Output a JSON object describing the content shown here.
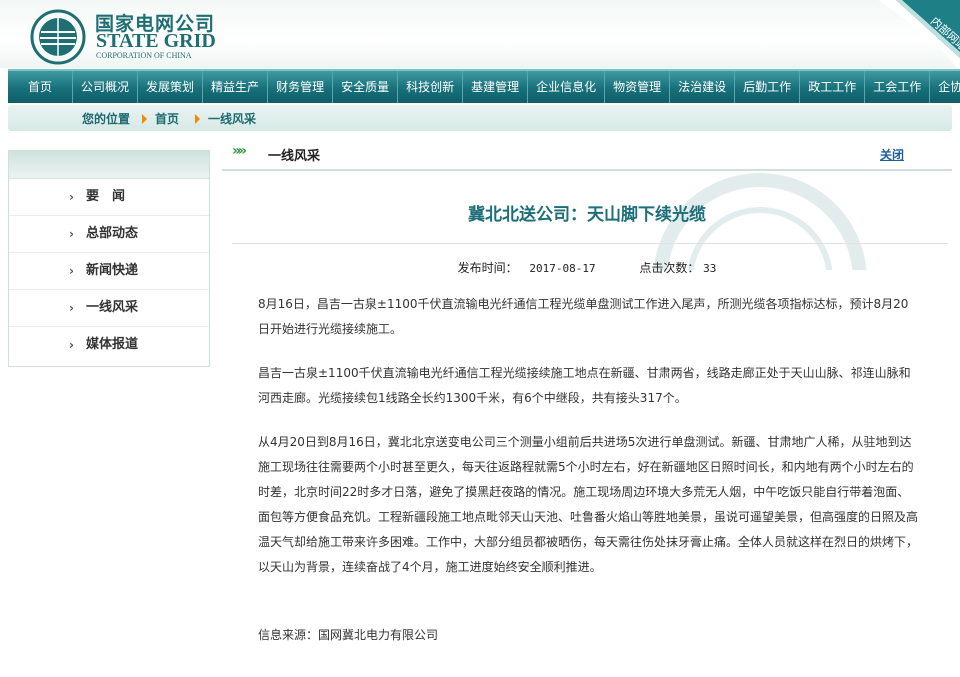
{
  "header": {
    "logo_cn": "国家电网公司",
    "logo_en": "STATE GRID",
    "logo_en_sub": "CORPORATION OF CHINA",
    "corner_badge": "内部网站"
  },
  "nav": {
    "items": [
      "首页",
      "公司概况",
      "发展策划",
      "精益生产",
      "财务管理",
      "安全质量",
      "科技创新",
      "基建管理",
      "企业信息化",
      "物资管理",
      "法治建设",
      "后勤工作",
      "政工工作",
      "工会工作",
      "企协信息"
    ]
  },
  "breadcrumb": {
    "label": "您的位置",
    "home": "首页",
    "current": "一线风采"
  },
  "sidebar": {
    "items": [
      {
        "label": "要　闻"
      },
      {
        "label": "总部动态"
      },
      {
        "label": "新闻快递"
      },
      {
        "label": "一线风采"
      },
      {
        "label": "媒体报道"
      }
    ]
  },
  "main": {
    "section_title": "一线风采",
    "close_label": "关闭",
    "article_title": "冀北北送公司：天山脚下续光缆",
    "publish_label": "发布时间：",
    "publish_date": "2017-08-17",
    "clicks_label": "点击次数：",
    "clicks": "33",
    "paragraphs": [
      "8月16日，昌吉一古泉±1100千伏直流输电光纤通信工程光缆单盘测试工作进入尾声，所测光缆各项指标达标，预计8月20日开始进行光缆接续施工。",
      "昌吉一古泉±1100千伏直流输电光纤通信工程光缆接续施工地点在新疆、甘肃两省，线路走廊正处于天山山脉、祁连山脉和河西走廊。光缆接续包1线路全长约1300千米，有6个中继段，共有接头317个。",
      "从4月20日到8月16日，冀北北京送变电公司三个测量小组前后共进场5次进行单盘测试。新疆、甘肃地广人稀，从驻地到达施工现场往往需要两个小时甚至更久，每天往返路程就需5个小时左右，好在新疆地区日照时间长，和内地有两个小时左右的时差，北京时间22时多才日落，避免了摸黑赶夜路的情况。施工现场周边环境大多荒无人烟，中午吃饭只能自行带着泡面、面包等方便食品充饥。工程新疆段施工地点毗邻天山天池、吐鲁番火焰山等胜地美景，虽说可遥望美景，但高强度的日照及高温天气却给施工带来许多困难。工作中，大部分组员都被晒伤，每天需往伤处抹牙膏止痛。全体人员就这样在烈日的烘烤下，以天山为背景，连续奋战了4个月，施工进度始终安全顺利推进。",
      "信息来源：国网冀北电力有限公司"
    ]
  },
  "colors": {
    "brand": "#1f6e73",
    "nav_bg": "#17707a",
    "accent": "#f08a00",
    "title": "#1b6e7a"
  }
}
